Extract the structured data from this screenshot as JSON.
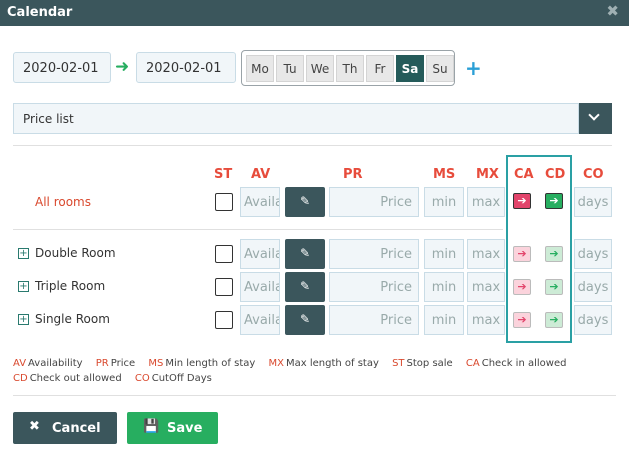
{
  "window": {
    "title": "Calendar",
    "close_icon": "✖"
  },
  "dates": {
    "from": "2020-02-01",
    "to": "2020-02-01",
    "arrow": "➜"
  },
  "weekdays": [
    {
      "label": "Mo",
      "on": false
    },
    {
      "label": "Tu",
      "on": false
    },
    {
      "label": "We",
      "on": false
    },
    {
      "label": "Th",
      "on": false
    },
    {
      "label": "Fr",
      "on": false
    },
    {
      "label": "Sa",
      "on": true
    },
    {
      "label": "Su",
      "on": false
    }
  ],
  "add_icon": "+",
  "price_list": {
    "value": "Price list"
  },
  "columns": {
    "st": "ST",
    "av": "AV",
    "pr": "PR",
    "ms": "MS",
    "mx": "MX",
    "ca": "CA",
    "cd": "CD",
    "co": "CO"
  },
  "placeholders": {
    "av": "Availa",
    "price": "Price",
    "min": "min",
    "max": "max",
    "days": "days"
  },
  "all_rooms": {
    "label": "All rooms"
  },
  "rooms": [
    {
      "label": "Double Room"
    },
    {
      "label": "Triple Room"
    },
    {
      "label": "Single Room"
    }
  ],
  "legend": {
    "line1": [
      {
        "code": "AV",
        "text": "Availability"
      },
      {
        "code": "PR",
        "text": "Price"
      },
      {
        "code": "MS",
        "text": "Min length of stay"
      },
      {
        "code": "MX",
        "text": "Max length of stay"
      },
      {
        "code": "ST",
        "text": "Stop sale"
      },
      {
        "code": "CA",
        "text": "Check in allowed"
      }
    ],
    "line2": [
      {
        "code": "CD",
        "text": "Check out allowed"
      },
      {
        "code": "CO",
        "text": "CutOff Days"
      }
    ]
  },
  "buttons": {
    "cancel": "Cancel",
    "save": "Save",
    "cancel_icon": "✖",
    "save_icon": "💾"
  },
  "colors": {
    "header": "#3b565c",
    "accent_red": "#e74c3c",
    "save_green": "#27ae60",
    "highlight": "#2aa0a4"
  }
}
